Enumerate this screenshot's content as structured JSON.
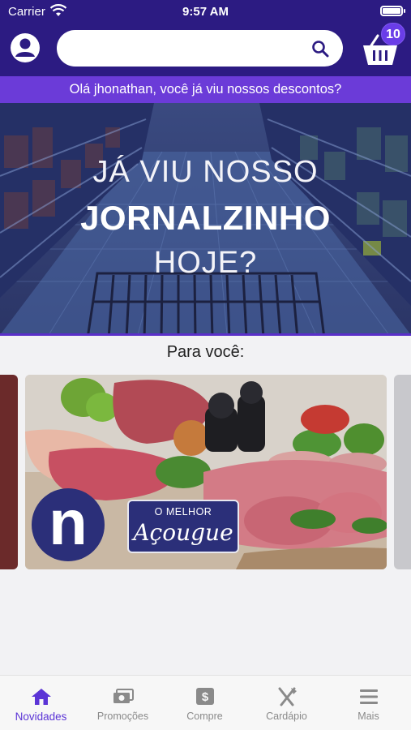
{
  "status_bar": {
    "carrier": "Carrier",
    "time": "9:57 AM"
  },
  "header": {
    "search": {
      "value": "",
      "placeholder": ""
    },
    "cart_count": "10",
    "greeting": "Olá jhonathan, você já viu nossos descontos?"
  },
  "hero": {
    "line1": "JÁ VIU NOSSO",
    "line2": "JORNALZINHO",
    "line3": "HOJE?"
  },
  "section": {
    "title": "Para você:"
  },
  "carousel": {
    "main_card": {
      "logo_letter": "n",
      "tag_top": "O MELHOR",
      "tag_main": "Açougue"
    }
  },
  "tabs": [
    {
      "label": "Novidades",
      "icon": "home-icon",
      "active": true
    },
    {
      "label": "Promoções",
      "icon": "money-icon",
      "active": false
    },
    {
      "label": "Compre",
      "icon": "dollar-box-icon",
      "active": false
    },
    {
      "label": "Cardápio",
      "icon": "fork-knife-icon",
      "active": false
    },
    {
      "label": "Mais",
      "icon": "hamburger-menu-icon",
      "active": false
    }
  ],
  "colors": {
    "header": "#2c1b82",
    "greeting_bar": "#6b3bd8",
    "accent": "#5b34d6",
    "badge": "#6a3de8",
    "promo_navy": "#2b2f79"
  }
}
